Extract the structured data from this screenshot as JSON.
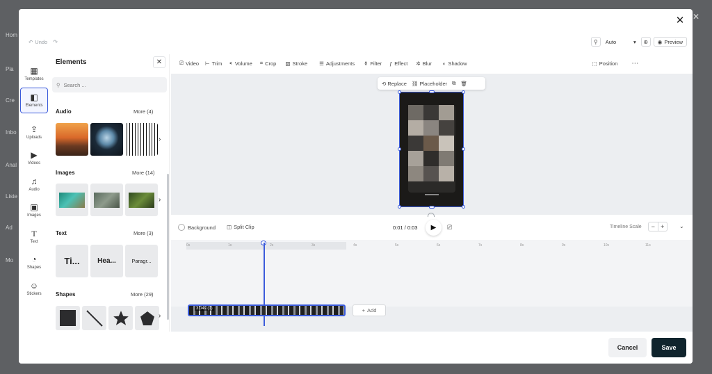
{
  "background_app": {
    "nav_fragments": [
      "Hom",
      "Pla",
      "Cre",
      "Inbo",
      "Anal",
      "Liste",
      "Ad",
      "Mo"
    ]
  },
  "modal": {
    "undo_label": "Undo",
    "zoom_value": "Auto",
    "preview_label": "Preview"
  },
  "left_nav": {
    "items": [
      {
        "label": "Templates",
        "icon": "templates-icon"
      },
      {
        "label": "Elements",
        "icon": "elements-icon"
      },
      {
        "label": "Uploads",
        "icon": "upload-icon"
      },
      {
        "label": "Videos",
        "icon": "video-icon"
      },
      {
        "label": "Audio",
        "icon": "music-note-icon"
      },
      {
        "label": "Images",
        "icon": "image-icon"
      },
      {
        "label": "Text",
        "icon": "text-icon"
      },
      {
        "label": "Shapes",
        "icon": "shapes-icon"
      },
      {
        "label": "Stickers",
        "icon": "sticker-icon"
      }
    ]
  },
  "elements_panel": {
    "title": "Elements",
    "search_placeholder": "Search ...",
    "sections": [
      {
        "title": "Audio",
        "more": "More (4)"
      },
      {
        "title": "Images",
        "more": "More (14)"
      },
      {
        "title": "Text",
        "more": "More (3)"
      },
      {
        "title": "Shapes",
        "more": "More (29)"
      }
    ],
    "text_items": [
      "Ti...",
      "Hea...",
      "Paragr..."
    ]
  },
  "toolbar": {
    "items": [
      "Video",
      "Trim",
      "Volume",
      "Crop",
      "Stroke",
      "Adjustments",
      "Filter",
      "Effect",
      "Blur",
      "Shadow"
    ],
    "position_label": "Position"
  },
  "canvas": {
    "replace_label": "Replace",
    "placeholder_label": "Placeholder"
  },
  "playback": {
    "background_label": "Background",
    "split_clip_label": "Split Clip",
    "time": "0:01 / 0:03",
    "timeline_scale_label": "Timeline Scale"
  },
  "timeline": {
    "ticks": [
      "0s",
      "1s",
      "2s",
      "3s",
      "4s",
      "5s",
      "6s",
      "7s",
      "8s",
      "9s",
      "10s",
      "11s"
    ],
    "clip_label": "3.04s (1)",
    "add_label": "Add"
  },
  "footer": {
    "cancel_label": "Cancel",
    "save_label": "Save"
  },
  "colors": {
    "accent": "#3b5bdb",
    "save_bg": "#10242d"
  }
}
